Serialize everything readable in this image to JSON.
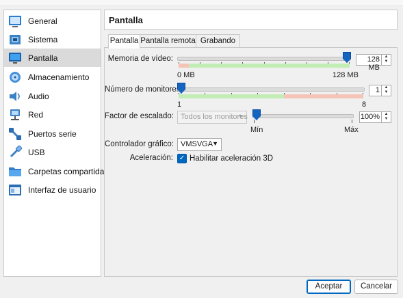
{
  "sidebar": {
    "selected_index": 2,
    "items": [
      {
        "label": "General",
        "icon": "general-icon"
      },
      {
        "label": "Sistema",
        "icon": "system-icon"
      },
      {
        "label": "Pantalla",
        "icon": "display-icon"
      },
      {
        "label": "Almacenamiento",
        "icon": "storage-icon"
      },
      {
        "label": "Audio",
        "icon": "audio-icon"
      },
      {
        "label": "Red",
        "icon": "network-icon"
      },
      {
        "label": "Puertos serie",
        "icon": "serial-ports-icon"
      },
      {
        "label": "USB",
        "icon": "usb-icon"
      },
      {
        "label": "Carpetas compartidas",
        "icon": "shared-folders-icon"
      },
      {
        "label": "Interfaz de usuario",
        "icon": "user-interface-icon"
      }
    ]
  },
  "header": {
    "title": "Pantalla"
  },
  "tabs": [
    {
      "label": "Pantalla",
      "active": true
    },
    {
      "label": "Pantalla remota",
      "active": false
    },
    {
      "label": "Grabando",
      "active": false
    }
  ],
  "video_memory": {
    "label": "Memoria de vídeo:",
    "value_text": "128 MB",
    "min_label": "0 MB",
    "max_label": "128 MB",
    "value_fraction": 1.0
  },
  "monitors": {
    "label": "Número de monitores:",
    "value_text": "1",
    "min_label": "1",
    "max_label": "8",
    "value_fraction": 0.0
  },
  "scale": {
    "label": "Factor de escalado:",
    "combo_value": "Todos los monitores",
    "value_text": "100%",
    "min_label": "Mín",
    "max_label": "Máx",
    "value_fraction": 0.0
  },
  "graphics_controller": {
    "label": "Controlador gráfico:",
    "value": "VMSVGA"
  },
  "acceleration": {
    "label": "Aceleración:",
    "checkbox_label": "Habilitar aceleración 3D",
    "checked": true
  },
  "buttons": {
    "accept": "Aceptar",
    "cancel": "Cancelar"
  },
  "colors": {
    "accent": "#0067c0",
    "slider_thumb": "#1565c0",
    "zone_ok": "#c2edb4",
    "zone_warn": "#f4c4b8"
  }
}
